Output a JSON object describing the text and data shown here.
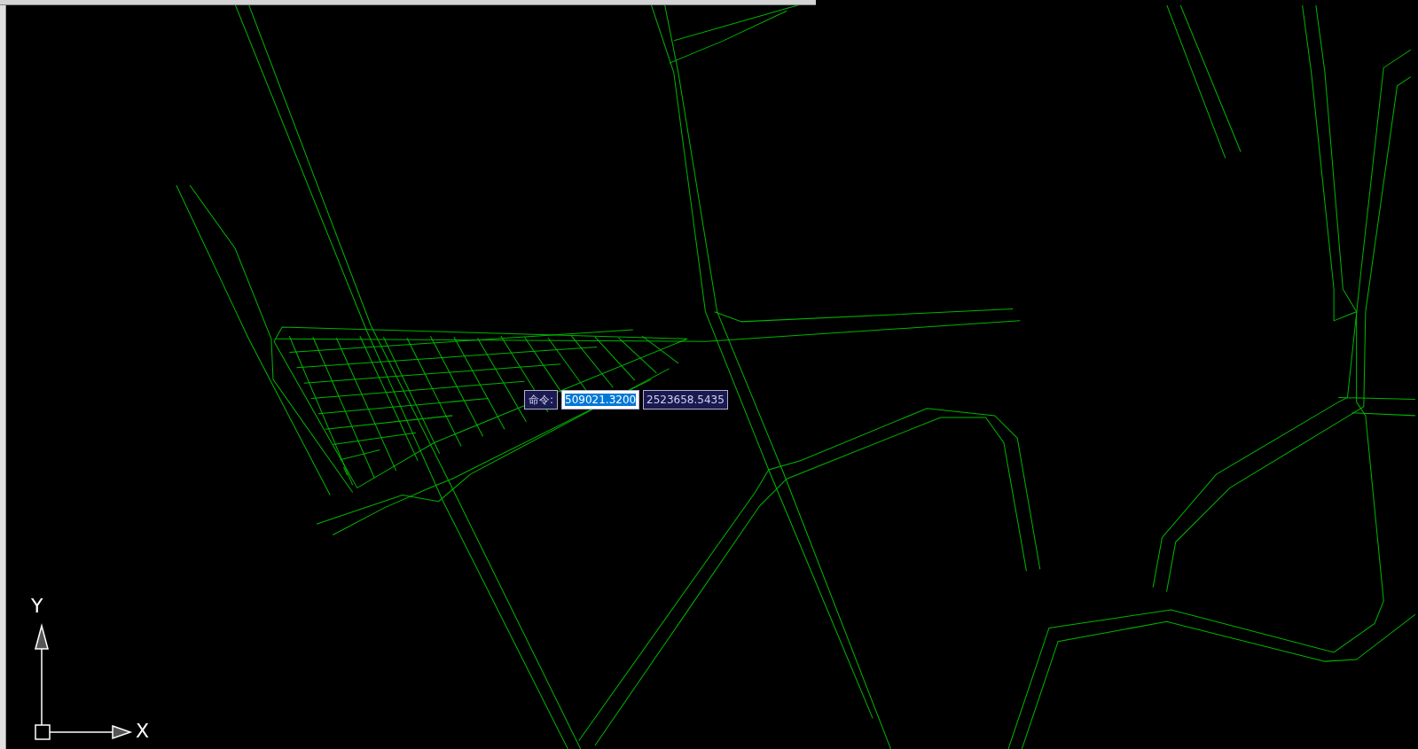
{
  "dynamic_input": {
    "prompt": "命令:",
    "x_value": "509021.3200",
    "y_value": "2523658.5435",
    "x_selected": true
  },
  "ucs_icon": {
    "x_label": "X",
    "y_label": "Y"
  }
}
